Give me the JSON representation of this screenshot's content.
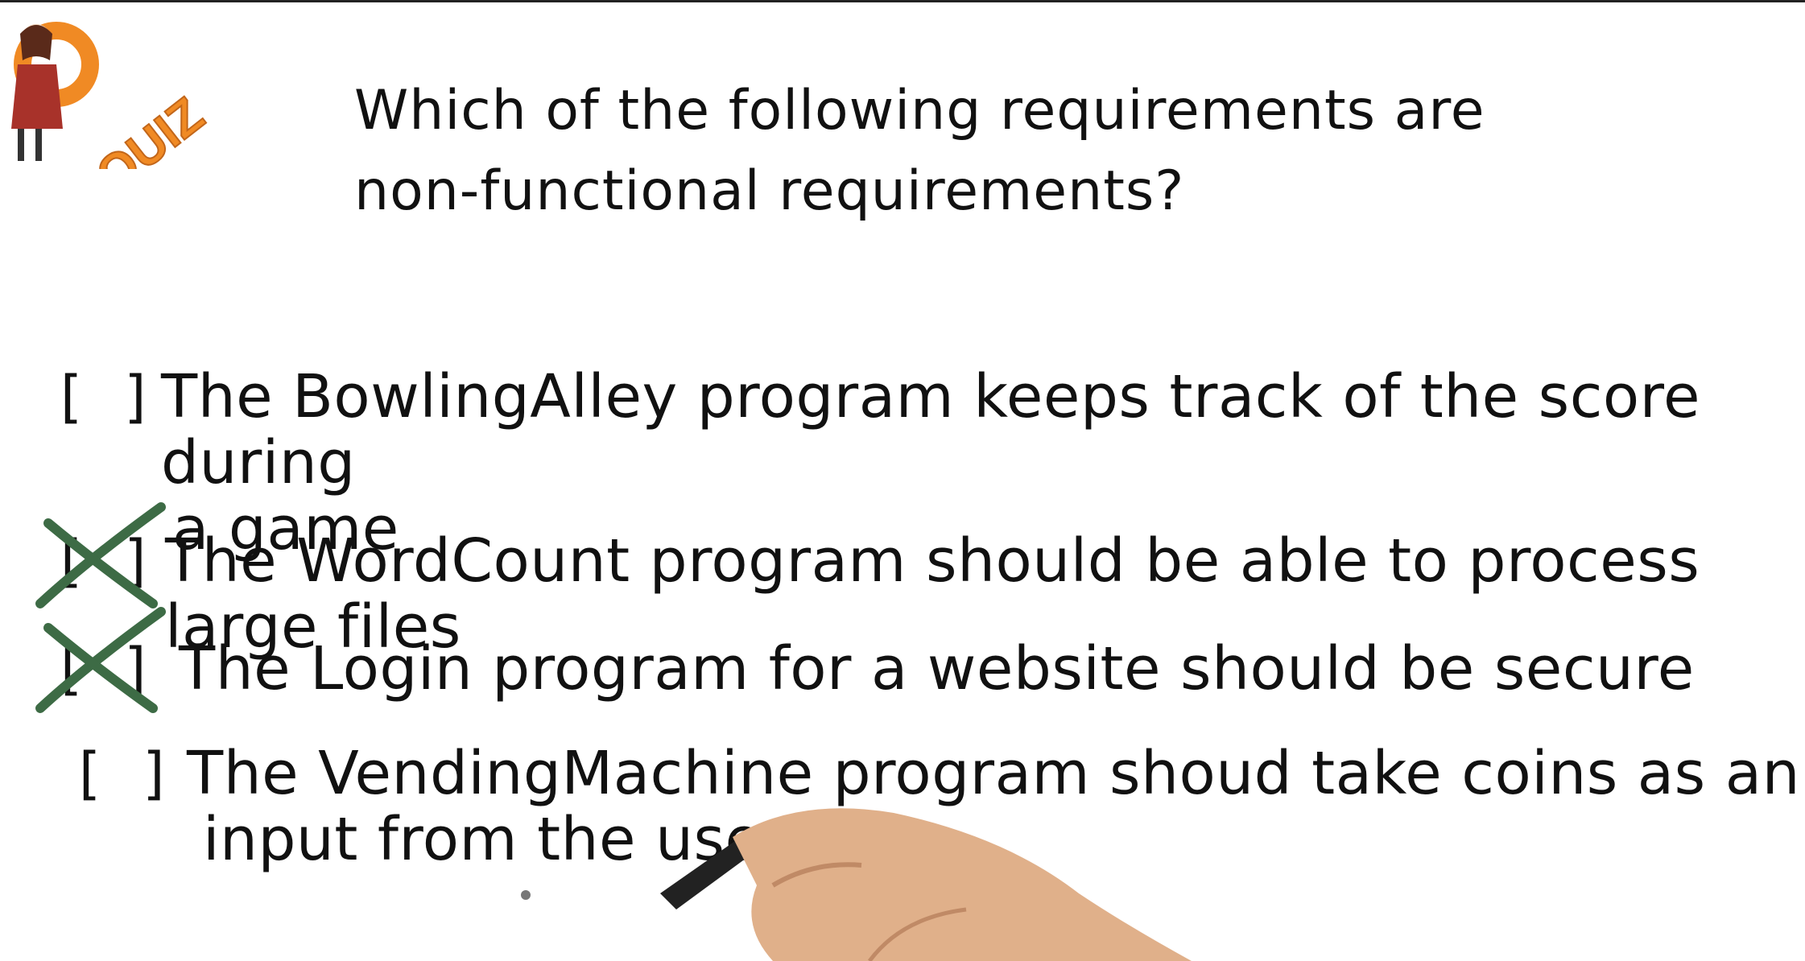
{
  "logo": {
    "text": "QUIZ",
    "icon": "quiz-mascot-icon",
    "color": "#f08a24"
  },
  "question": {
    "line1": "Which of the following requirements are",
    "line2": "non-functional requirements?"
  },
  "options": [
    {
      "box": "[ ]",
      "line1": "The BowlingAlley program keeps track of the score during",
      "line2": "a game",
      "checked": false
    },
    {
      "box": "[ ]",
      "line1": "The WordCount program should be able to process large files",
      "line2": "",
      "checked": true
    },
    {
      "box": "[ ]",
      "line1": "The Login program for a website should be secure",
      "line2": "",
      "checked": true
    },
    {
      "box": "[ ]",
      "line1": "The VendingMachine program shoud take coins as an",
      "line2": "input from the user.",
      "checked": false
    }
  ],
  "colors": {
    "ink": "#111111",
    "check": "#3d6b45",
    "accent": "#f08a24"
  }
}
